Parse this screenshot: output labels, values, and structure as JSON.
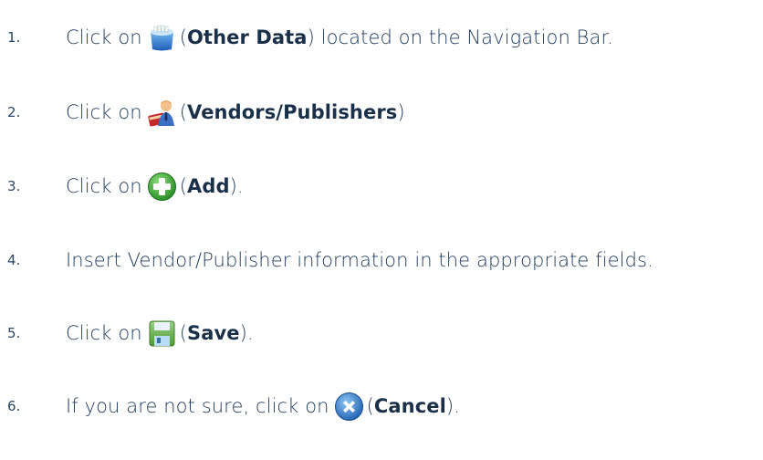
{
  "steps": [
    {
      "number": "1.",
      "prefix": "Click on",
      "icon": "other-data-icon",
      "open": "(",
      "bold": "Other Data",
      "suffix": ") located on the Navigation Bar."
    },
    {
      "number": "2.",
      "prefix": "Click on",
      "icon": "vendors-publishers-icon",
      "open": "(",
      "bold": "Vendors/Publishers",
      "suffix": ")"
    },
    {
      "number": "3.",
      "prefix": "Click on",
      "icon": "add-icon",
      "open": "(",
      "bold": "Add",
      "suffix": ")."
    },
    {
      "number": "4.",
      "text": "Insert Vendor/Publisher information in the appropriate fields."
    },
    {
      "number": "5.",
      "prefix": "Click on",
      "icon": "save-icon",
      "open": "(",
      "bold": "Save",
      "suffix": ")."
    },
    {
      "number": "6.",
      "prefix": "If you are not sure, click on",
      "icon": "cancel-icon",
      "open": "(",
      "bold": "Cancel",
      "suffix": ")."
    }
  ],
  "colors": {
    "text": "#1f3a5a",
    "add_green": "#3aa63a",
    "cancel_blue": "#2f7fd0",
    "folder_blue": "#3d86d8",
    "save_green": "#5aa83a"
  }
}
